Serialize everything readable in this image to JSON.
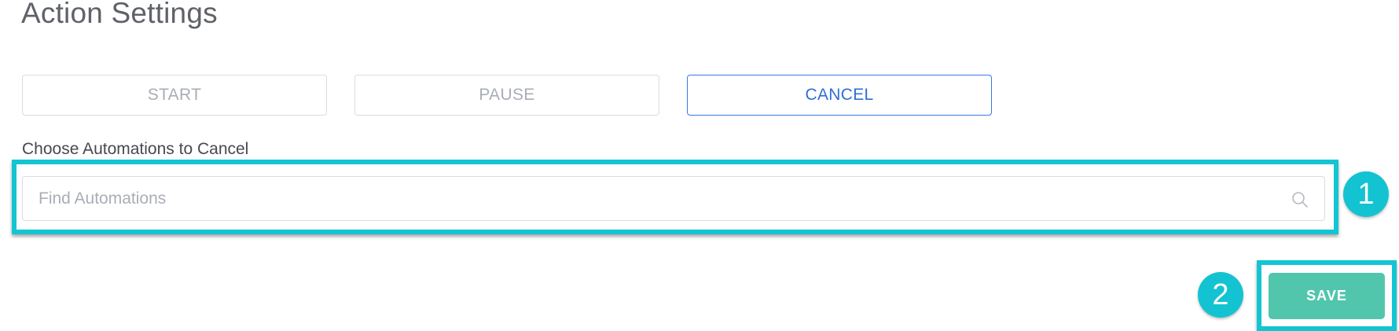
{
  "page": {
    "title": "Action Settings"
  },
  "actions": {
    "start_label": "START",
    "pause_label": "PAUSE",
    "cancel_label": "CANCEL",
    "selected": "CANCEL"
  },
  "automations": {
    "label": "Choose Automations to Cancel",
    "placeholder": "Find Automations",
    "value": ""
  },
  "callouts": {
    "step_1": "1",
    "step_2": "2"
  },
  "footer": {
    "save_label": "SAVE"
  },
  "colors": {
    "highlight": "#13c5d2",
    "active_border": "#3a78e0",
    "save_button": "#52c6ad"
  },
  "icons": {
    "search": "search-icon"
  }
}
